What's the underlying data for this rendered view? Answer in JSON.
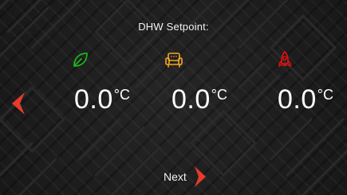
{
  "header": {
    "title": "DHW Setpoint:"
  },
  "modes": [
    {
      "icon": "leaf-icon",
      "color": "#1db31d",
      "value": "0.0",
      "unit": "°C"
    },
    {
      "icon": "armchair-icon",
      "color": "#f5a623",
      "value": "0.0",
      "unit": "°C"
    },
    {
      "icon": "rocket-icon",
      "color": "#e01010",
      "value": "0.0",
      "unit": "°C"
    }
  ],
  "navigation": {
    "prev_icon": "chevron-left-icon",
    "next_label": "Next",
    "next_icon": "chevron-right-icon",
    "arrow_color": "#e83a2c"
  },
  "theme": {
    "background": "#1d1d1d",
    "text": "#ffffff"
  }
}
